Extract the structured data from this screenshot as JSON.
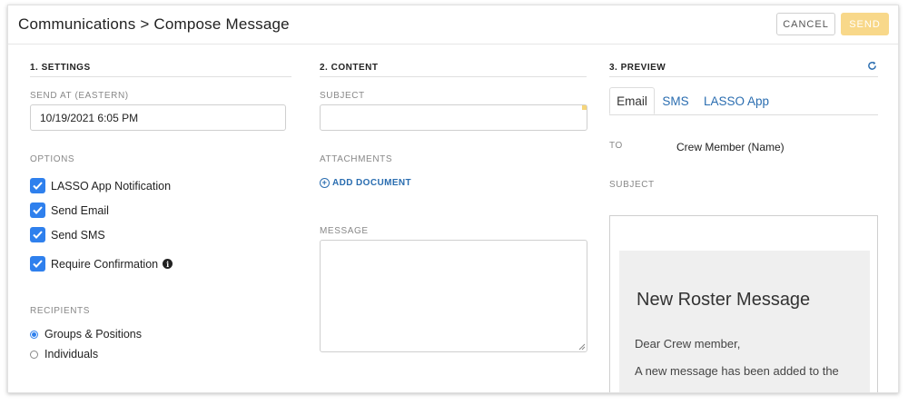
{
  "header": {
    "title": "Communications > Compose Message",
    "cancel_label": "CANCEL",
    "send_label": "SEND"
  },
  "settings": {
    "heading": "1. SETTINGS",
    "send_at_label": "SEND AT (EASTERN)",
    "send_at_value": "10/19/2021 6:05 PM",
    "options_label": "OPTIONS",
    "options": [
      {
        "label": "LASSO App Notification",
        "checked": true
      },
      {
        "label": "Send Email",
        "checked": true
      },
      {
        "label": "Send SMS",
        "checked": true
      },
      {
        "label": "Require Confirmation",
        "checked": true
      }
    ],
    "recipients_label": "RECIPIENTS",
    "recipients": [
      {
        "label": "Groups & Positions",
        "selected": true
      },
      {
        "label": "Individuals",
        "selected": false
      }
    ]
  },
  "content": {
    "heading": "2. CONTENT",
    "subject_label": "SUBJECT",
    "subject_value": "",
    "attachments_label": "ATTACHMENTS",
    "add_document_label": "ADD DOCUMENT",
    "message_label": "MESSAGE",
    "message_value": ""
  },
  "preview": {
    "heading": "3. PREVIEW",
    "tabs": [
      {
        "label": "Email",
        "active": true
      },
      {
        "label": "SMS",
        "active": false
      },
      {
        "label": "LASSO App",
        "active": false
      }
    ],
    "to_label": "TO",
    "to_value": "Crew Member (Name)",
    "subject_label": "SUBJECT",
    "email_title": "New Roster Message",
    "email_greeting": "Dear Crew member,",
    "email_body": "A new message has been added to the"
  },
  "colors": {
    "accent": "#2f80ed",
    "link": "#2a6db0",
    "send_button": "#f8d88a"
  },
  "icons": {
    "refresh": "refresh-icon",
    "info": "info-icon",
    "add": "plus-circle-icon",
    "check": "checkmark-icon"
  }
}
